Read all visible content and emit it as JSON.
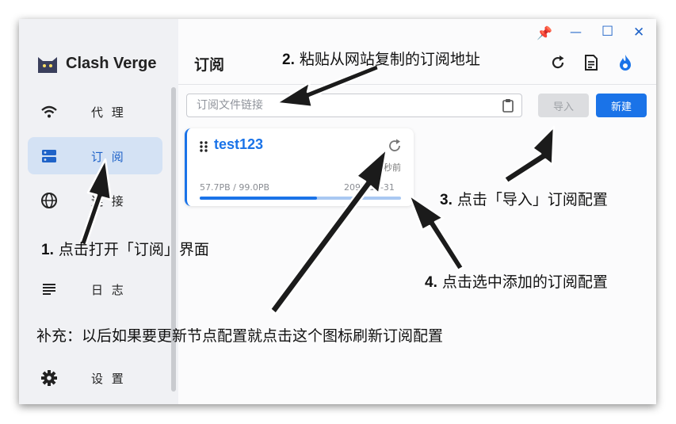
{
  "app": {
    "name": "Clash Verge"
  },
  "window_controls": {
    "pin": "📌",
    "minimize": "—",
    "maximize": "☐",
    "close": "✕"
  },
  "sidebar": {
    "items": [
      {
        "label": "代 理",
        "icon": "wifi-icon"
      },
      {
        "label": "订 阅",
        "icon": "storage-icon",
        "active": true
      },
      {
        "label": "连 接",
        "icon": "globe-icon"
      },
      {
        "label": "日 志",
        "icon": "list-icon"
      },
      {
        "label": "设 置",
        "icon": "gear-icon"
      }
    ]
  },
  "header": {
    "title": "订阅"
  },
  "import_bar": {
    "placeholder": "订阅文件链接",
    "import_label": "导入",
    "new_label": "新建"
  },
  "profile": {
    "name": "test123",
    "updated": "秒前",
    "usage": "57.7PB / 99.0PB",
    "expire": "2099-12-31",
    "progress": 0.583
  },
  "annotations": {
    "a1_num": "1.",
    "a1_text": "点击打开「订阅」界面",
    "a2_num": "2.",
    "a2_text": "粘贴从网站复制的订阅地址",
    "a3_num": "3.",
    "a3_text": "点击「导入」订阅配置",
    "a4_num": "4.",
    "a4_text": "点击选中添加的订阅配置",
    "note": "补充：以后如果要更新节点配置就点击这个图标刷新订阅配置"
  },
  "colors": {
    "accent": "#1a73e8",
    "active_bg": "#d4e2f4"
  }
}
